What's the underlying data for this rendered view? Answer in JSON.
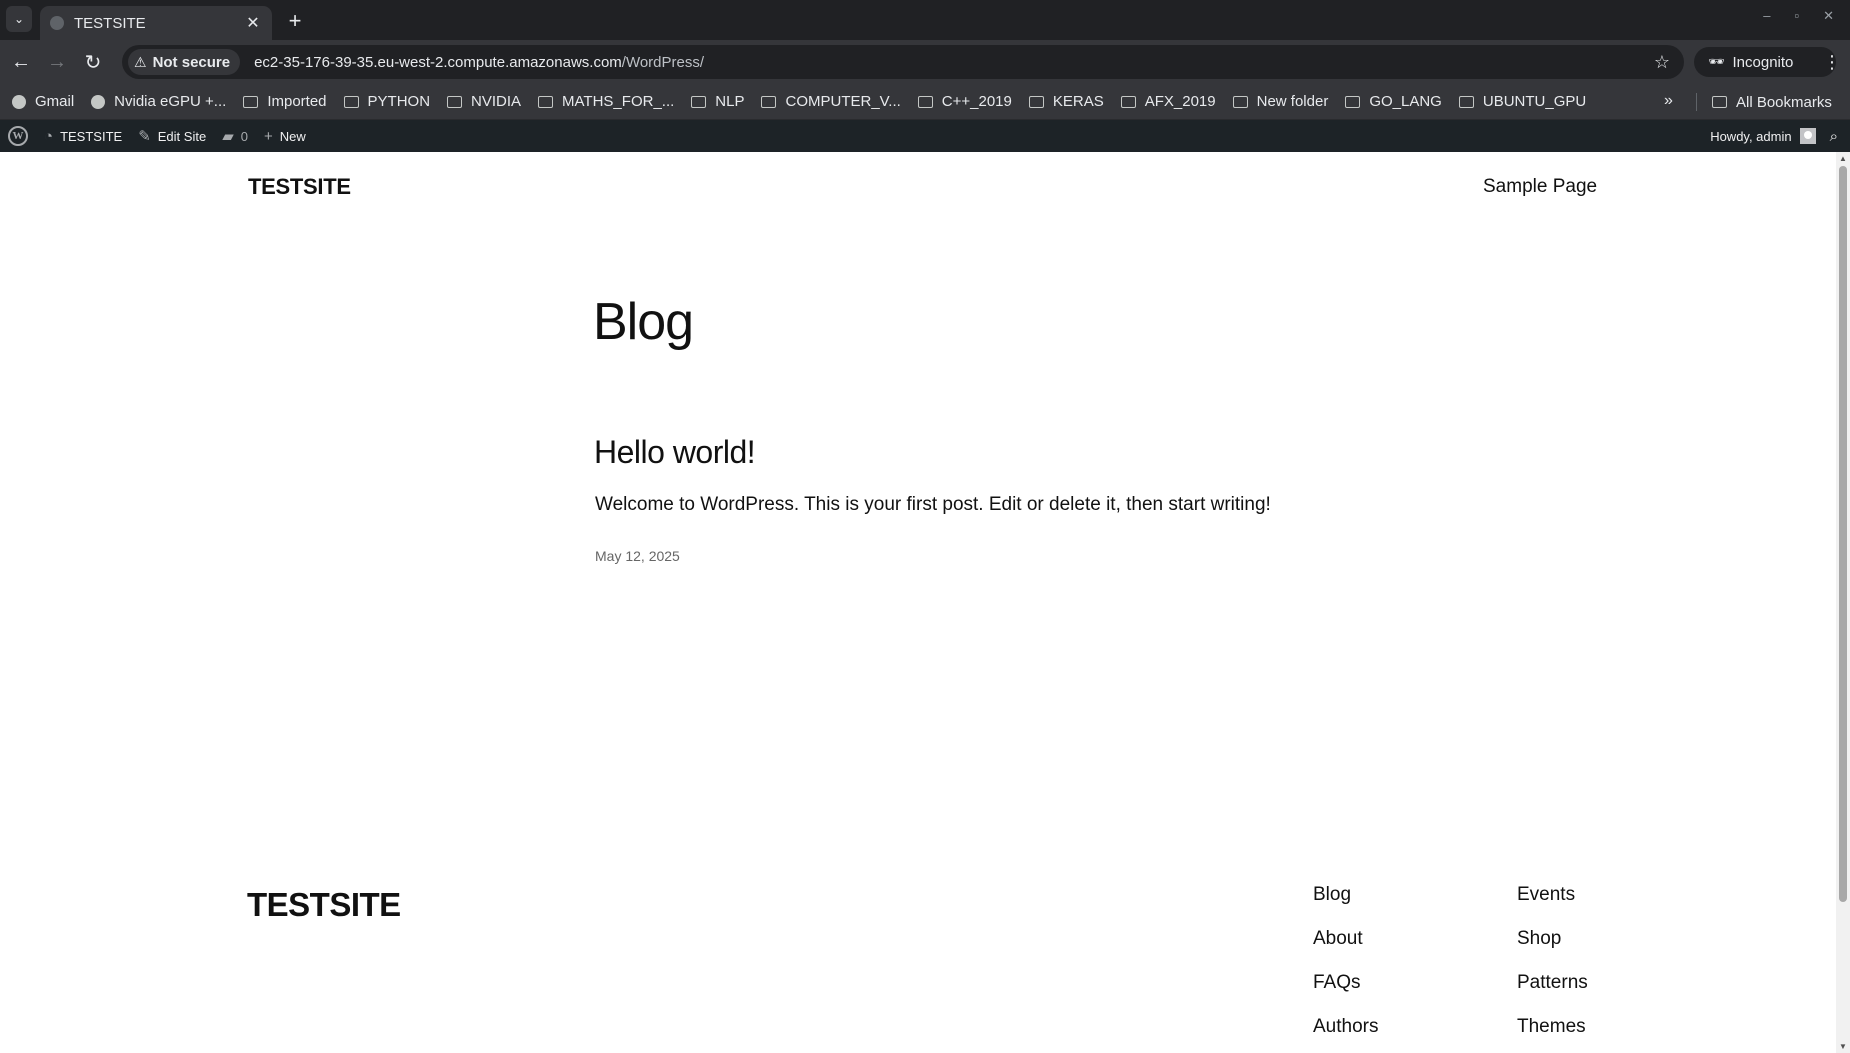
{
  "browser": {
    "tab_title": "TESTSITE",
    "security_label": "Not secure",
    "url_host": "ec2-35-176-39-35.eu-west-2.compute.amazonaws.com",
    "url_path": "/WordPress/",
    "profile_label": "Incognito",
    "bookmarks": [
      "Gmail",
      "Nvidia eGPU +...",
      "Imported",
      "PYTHON",
      "NVIDIA",
      "MATHS_FOR_...",
      "NLP",
      "COMPUTER_V...",
      "C++_2019",
      "KERAS",
      "AFX_2019",
      "New folder",
      "GO_LANG",
      "UBUNTU_GPU"
    ],
    "all_bookmarks_label": "All Bookmarks"
  },
  "adminbar": {
    "site_label": "TESTSITE",
    "edit_site_label": "Edit Site",
    "comments_count": "0",
    "new_label": "New",
    "howdy_label": "Howdy, admin"
  },
  "site": {
    "title": "TESTSITE",
    "nav": [
      "Sample Page"
    ]
  },
  "main": {
    "heading": "Blog",
    "posts": [
      {
        "title": "Hello world!",
        "excerpt": "Welcome to WordPress. This is your first post. Edit or delete it, then start writing!",
        "date": "May 12, 2025"
      }
    ]
  },
  "footer": {
    "title": "TESTSITE",
    "col1": [
      "Blog",
      "About",
      "FAQs",
      "Authors"
    ],
    "col2": [
      "Events",
      "Shop",
      "Patterns",
      "Themes"
    ]
  }
}
